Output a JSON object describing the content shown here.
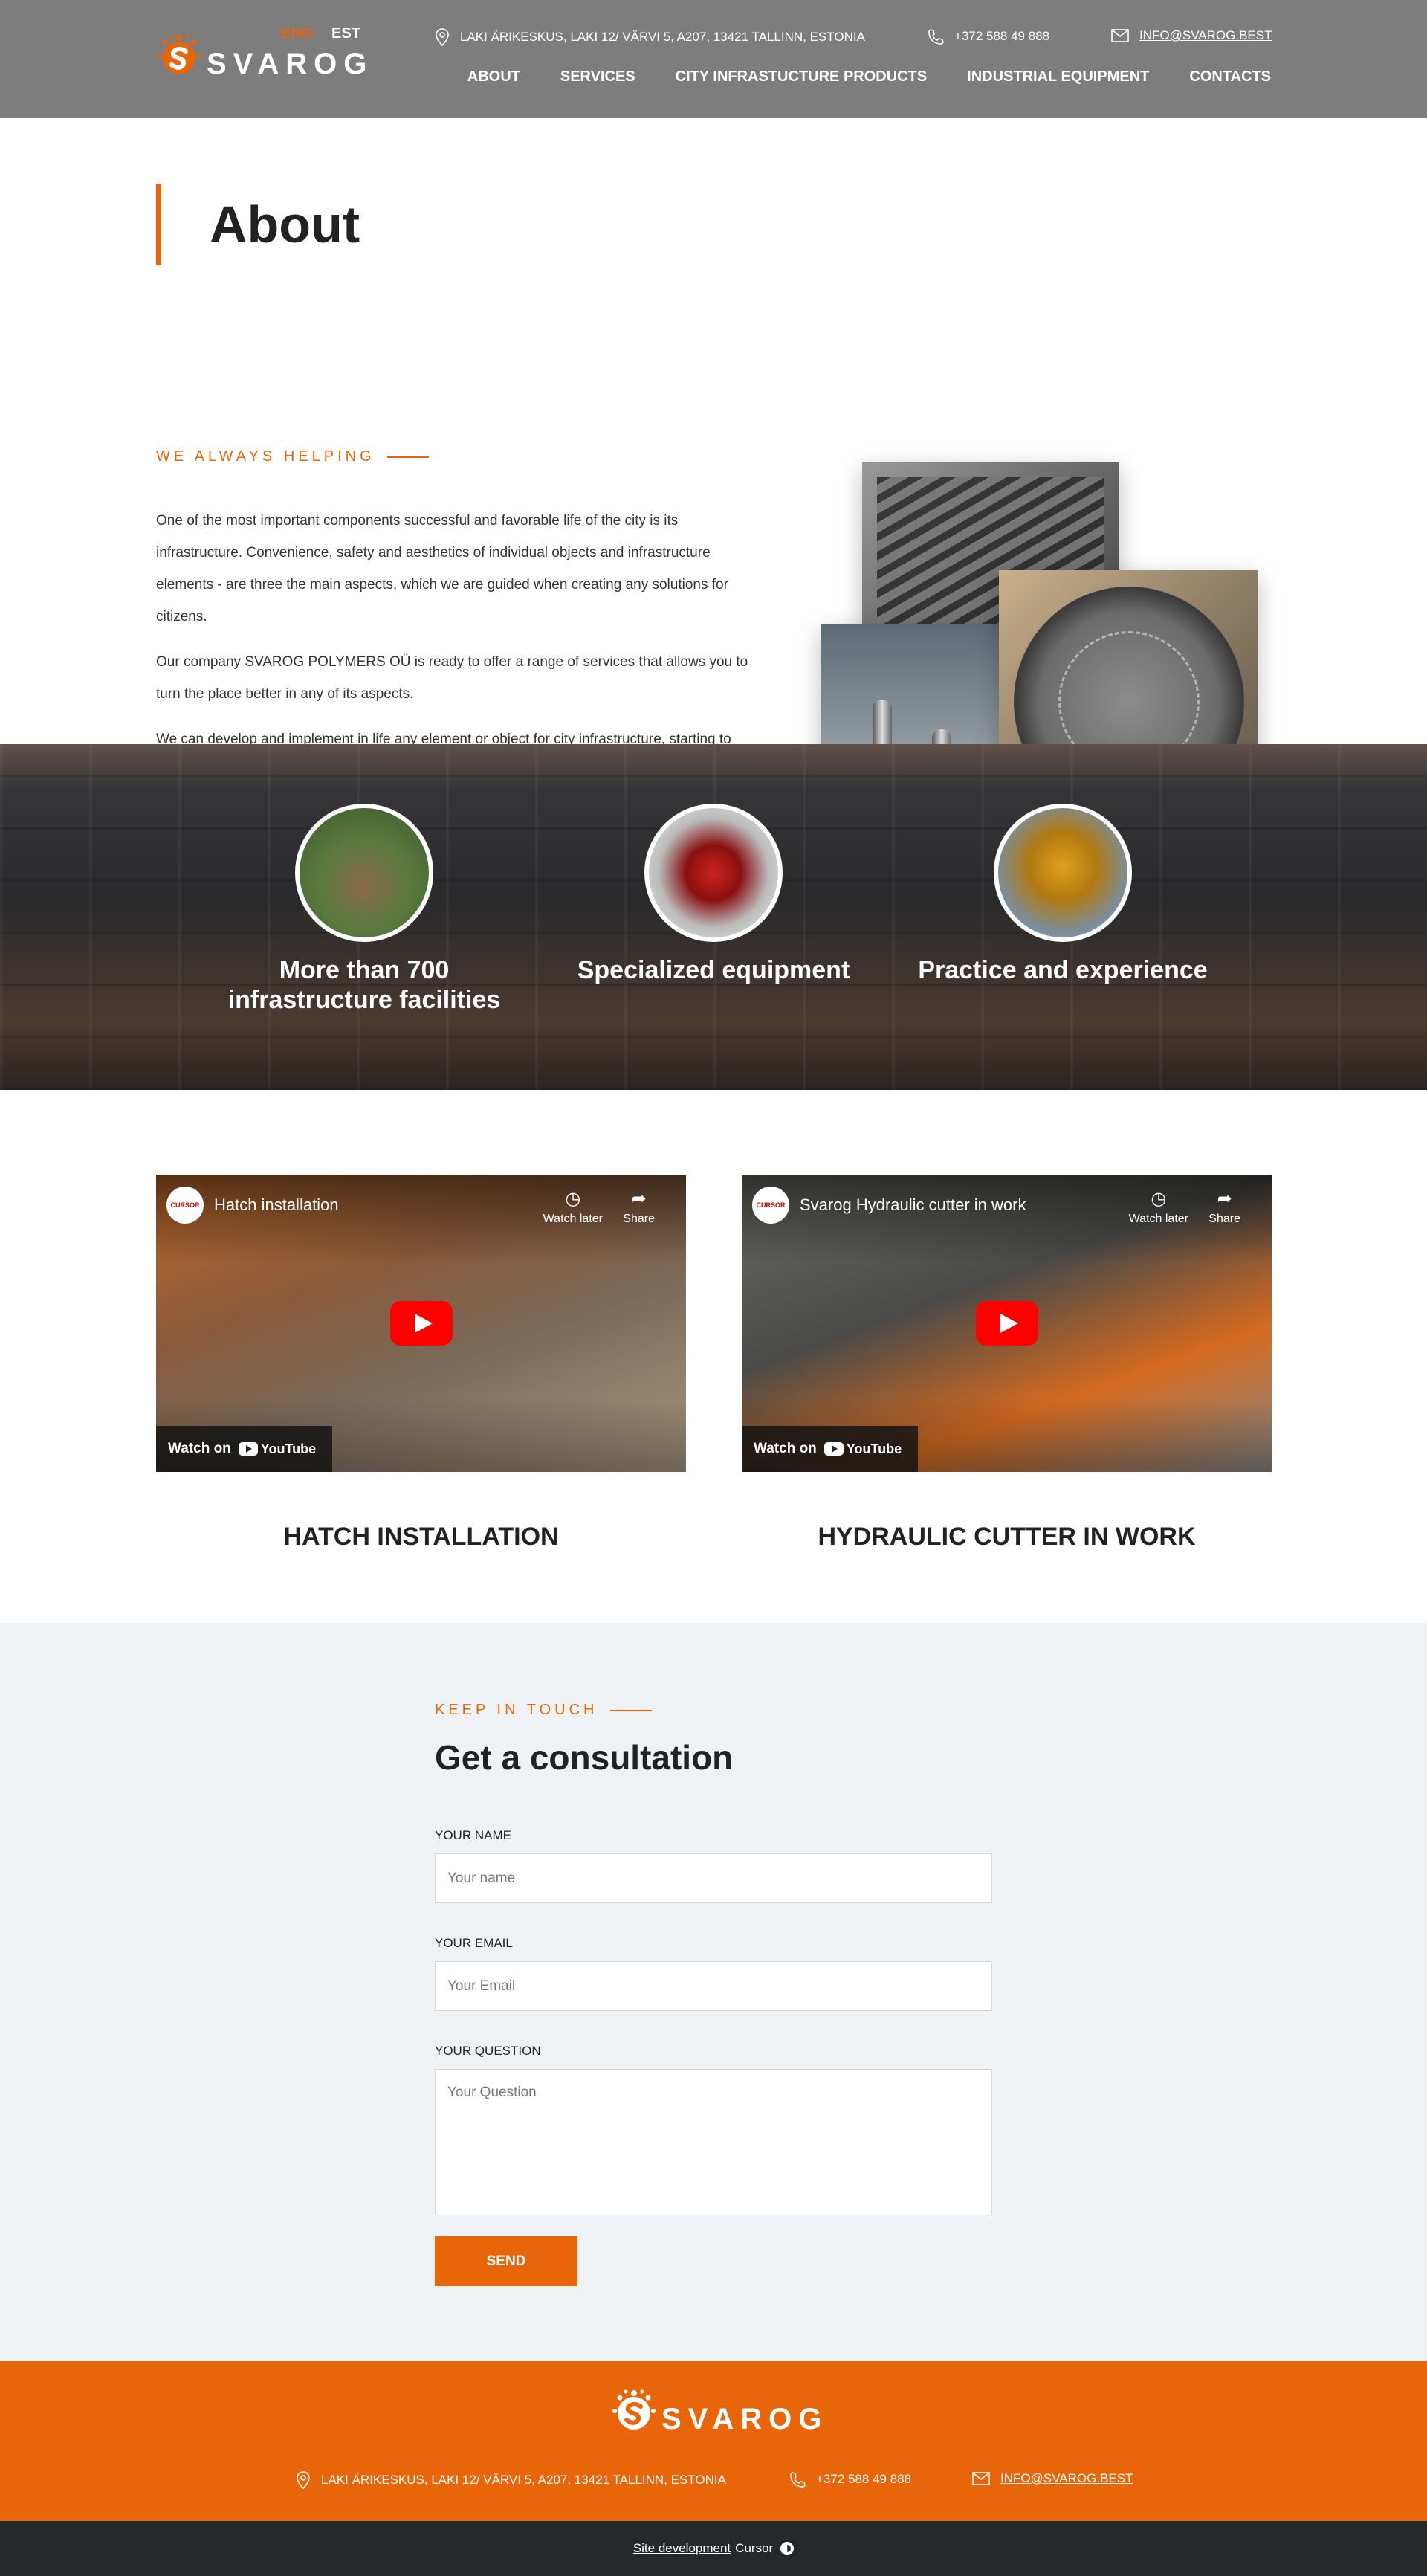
{
  "header": {
    "brand": "SVAROG",
    "lang_active": "ENG",
    "lang_other": "EST",
    "address": "LAKI ÄRIKESKUS, LAKI 12/ VÄRVI 5, A207, 13421 TALLINN, ESTONIA",
    "phone": "+372 588 49 888",
    "email": "INFO@SVAROG.BEST",
    "nav": [
      "ABOUT",
      "SERVICES",
      "CITY INFRASTUCTURE PRODUCTS",
      "INDUSTRIAL EQUIPMENT",
      "CONTACTS"
    ]
  },
  "about": {
    "title": "About",
    "eyebrow": "WE ALWAYS HELPING",
    "paragraphs": [
      "One of the most important components successful and favorable life of the city is its infrastructure. Convenience, safety and aesthetics of individual objects and infrastructure elements - are three the main aspects, which we are guided when creating any solutions for citizens.",
      "Our company SVAROG POLYMERS OÜ is ready to offer a range of services that allows you to turn the place better in any of its aspects.",
      "We can develop and implement in life any element or object for city infrastructure, starting to decorate fence, and ending with pavilions or sports grounds"
    ]
  },
  "features": [
    {
      "label_line1": "More than 700",
      "label_line2": "infrastructure facilities"
    },
    {
      "label_line1": "Specialized equipment",
      "label_line2": ""
    },
    {
      "label_line1": "Practice and experience",
      "label_line2": ""
    }
  ],
  "videos": [
    {
      "title": "Hatch installation",
      "channel": "CURSOR",
      "watch_later": "Watch later",
      "share": "Share",
      "watch_on": "Watch on",
      "youtube": "YouTube",
      "caption": "HATCH INSTALLATION"
    },
    {
      "title": "Svarog Hydraulic cutter in work",
      "channel": "CURSOR",
      "watch_later": "Watch later",
      "share": "Share",
      "watch_on": "Watch on",
      "youtube": "YouTube",
      "caption": "HYDRAULIC CUTTER IN WORK"
    }
  ],
  "consult": {
    "eyebrow": "KEEP IN TOUCH",
    "title": "Get a consultation",
    "name_label": "YOUR NAME",
    "name_placeholder": "Your name",
    "email_label": "YOUR EMAIL",
    "email_placeholder": "Your Email",
    "question_label": "YOUR QUESTION",
    "question_placeholder": "Your Question",
    "send_label": "SEND"
  },
  "footer": {
    "brand": "SVAROG",
    "address": "LAKI ÄRIKESKUS, LAKI 12/ VÄRVI 5, A207, 13421 TALLINN, ESTONIA",
    "phone": "+372 588 49 888",
    "email": "INFO@SVAROG.BEST",
    "dev_label": "Site development",
    "dev_name": "Cursor"
  },
  "colors": {
    "accent": "#e8650a",
    "header_bg": "#7d7d7d",
    "consult_bg": "#eff2f5",
    "bottom_bg": "#26282b"
  }
}
